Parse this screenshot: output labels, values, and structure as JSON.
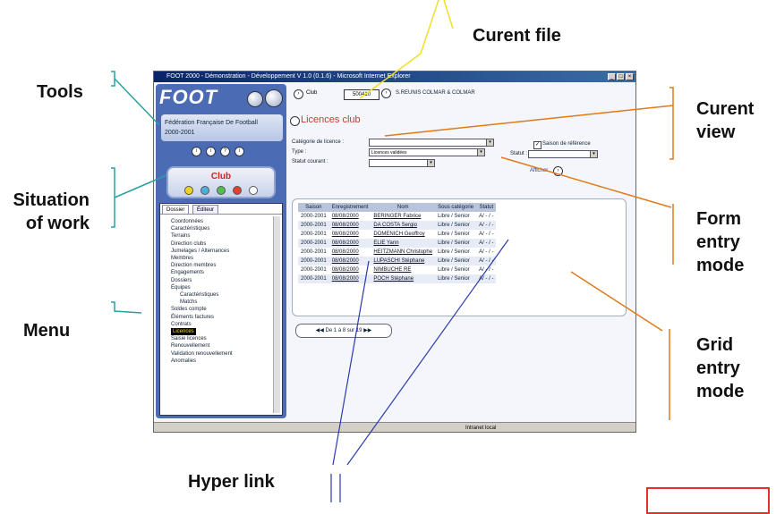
{
  "callouts": {
    "curent_file": "Curent file",
    "tools": "Tools",
    "curent_view": [
      "Curent",
      "view"
    ],
    "situation_of_work": [
      "Situation",
      "of work"
    ],
    "form_entry_mode": [
      "Form",
      "entry",
      "mode"
    ],
    "menu": "Menu",
    "grid_entry_mode": [
      "Grid",
      "entry",
      "mode"
    ],
    "hyper_link": "Hyper link"
  },
  "window": {
    "title": "FOOT 2000 - Démonstration - Développement V 1.0 (0.1.6) - Microsoft Internet Explorer",
    "controls": [
      "_",
      "□",
      "×"
    ]
  },
  "logo": {
    "text": "FOOT"
  },
  "org": {
    "name": "Fédération Française De Football",
    "season": "2000-2001"
  },
  "club_panel": {
    "label": "Club"
  },
  "menu": {
    "tabs": [
      "Dossier",
      "Éditeur"
    ],
    "items": [
      "Coordonnées",
      "Caractéristiques",
      "Terrains",
      "Direction clubs",
      "Jumelages / Alternances",
      "Membres",
      "Direction membres",
      "Engagements",
      "Dossiers",
      "Équipes",
      "Caractéristiques",
      "Matchs",
      "Soldes compte",
      "Éléments factures",
      "Contrats",
      "Licences",
      "Saisie licences",
      "Renouvellement",
      "Validation renouvellement",
      "Anomalies"
    ],
    "selected": "Licences"
  },
  "topbar": {
    "club_label": "Club",
    "club_code": "500410",
    "club_name": "S.REUNIS COLMAR & COLMAR"
  },
  "view": {
    "title": "Licences club",
    "form": {
      "categorie_label": "Catégorie de licence :",
      "type_label": "Type :",
      "type_value": "Licences validées",
      "statut_label": "Statut courant :",
      "saison_ref_label": "Saison de référence",
      "statut2_label": "Statut :",
      "afficher_label": "Afficher"
    },
    "grid": {
      "columns": [
        "Saison",
        "Enregistrement",
        "Nom",
        "Sous catégorie",
        "Statut"
      ],
      "rows": [
        [
          "2000-2001",
          "08/08/2000",
          "BERINGER Fabrice",
          "Libre / Senior",
          "A/ - / -"
        ],
        [
          "2000-2001",
          "08/08/2000",
          "DA COSTA Sergio",
          "Libre / Senior",
          "A/ - / -"
        ],
        [
          "2000-2001",
          "08/08/2000",
          "DOMENICH Geoffroy",
          "Libre / Senior",
          "A/ - / -"
        ],
        [
          "2000-2001",
          "08/08/2000",
          "ELIE Yann",
          "Libre / Senior",
          "A/ - / -"
        ],
        [
          "2000-2001",
          "08/08/2000",
          "HEITZMANN Christophe",
          "Libre / Senior",
          "A/ - / -"
        ],
        [
          "2000-2001",
          "08/08/2000",
          "LUPASCHI Stéphane",
          "Libre / Senior",
          "A/ - / -"
        ],
        [
          "2000-2001",
          "08/08/2000",
          "NIMBUCHE RE",
          "Libre / Senior",
          "A/ - / -"
        ],
        [
          "2000-2001",
          "08/08/2000",
          "POCH Stéphane",
          "Libre / Senior",
          "A/ - / -"
        ]
      ]
    },
    "pager": "De 1 à 8 sur 19"
  },
  "statusbar": {
    "zone": "Intranet local"
  },
  "colors": {
    "window_title_bg": "#0a246a",
    "left_panel_bg": "#4b6cb4",
    "view_title": "#c83a2a",
    "club_label": "#d02020",
    "callout_tools": "#2aa0a0",
    "callout_file": "#f0e020",
    "callout_view": "#e07a1a",
    "callout_link": "#2a3ab0",
    "bottom_box": "#e03030"
  }
}
